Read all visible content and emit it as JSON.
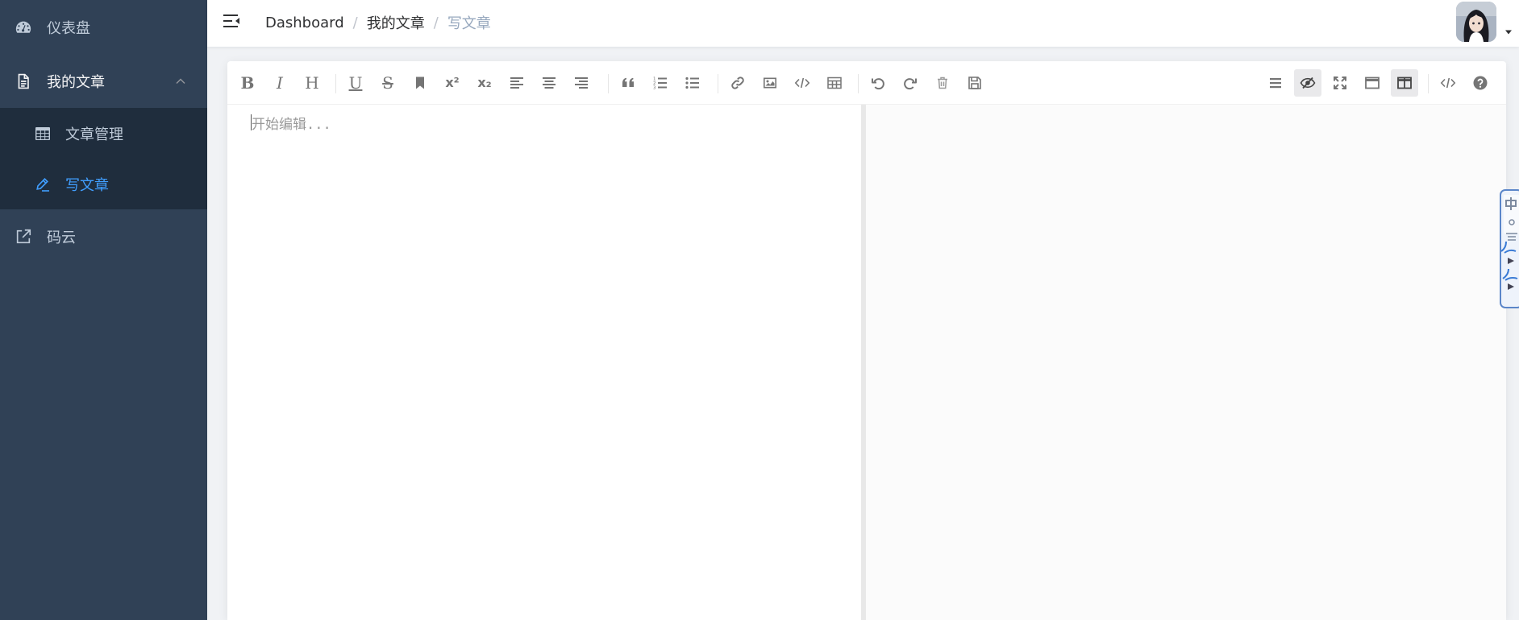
{
  "sidebar": {
    "dashboard": {
      "label": "仪表盘",
      "icon": "dashboard-icon"
    },
    "articles": {
      "label": "我的文章",
      "icon": "document-icon",
      "expanded": true,
      "children": [
        {
          "label": "文章管理",
          "icon": "table-icon",
          "active": false
        },
        {
          "label": "写文章",
          "icon": "edit-icon",
          "active": true
        }
      ]
    },
    "gitee": {
      "label": "码云",
      "icon": "external-link-icon"
    }
  },
  "navbar": {
    "breadcrumb": [
      {
        "label": "Dashboard"
      },
      {
        "label": "我的文章"
      },
      {
        "label": "写文章"
      }
    ],
    "separator": "/"
  },
  "editor": {
    "placeholder": "开始编辑...",
    "toolbar": {
      "bold": "B",
      "italic": "I",
      "header": "H",
      "underline": "U",
      "strikethrough": "S",
      "superscript": "x²",
      "subscript": "x₂"
    }
  },
  "colors": {
    "sidebar_bg": "#304156",
    "submenu_bg": "#1f2d3d",
    "sidebar_text": "#bfcbd9",
    "active": "#409eff",
    "breadcrumb_current": "#97a8be"
  }
}
